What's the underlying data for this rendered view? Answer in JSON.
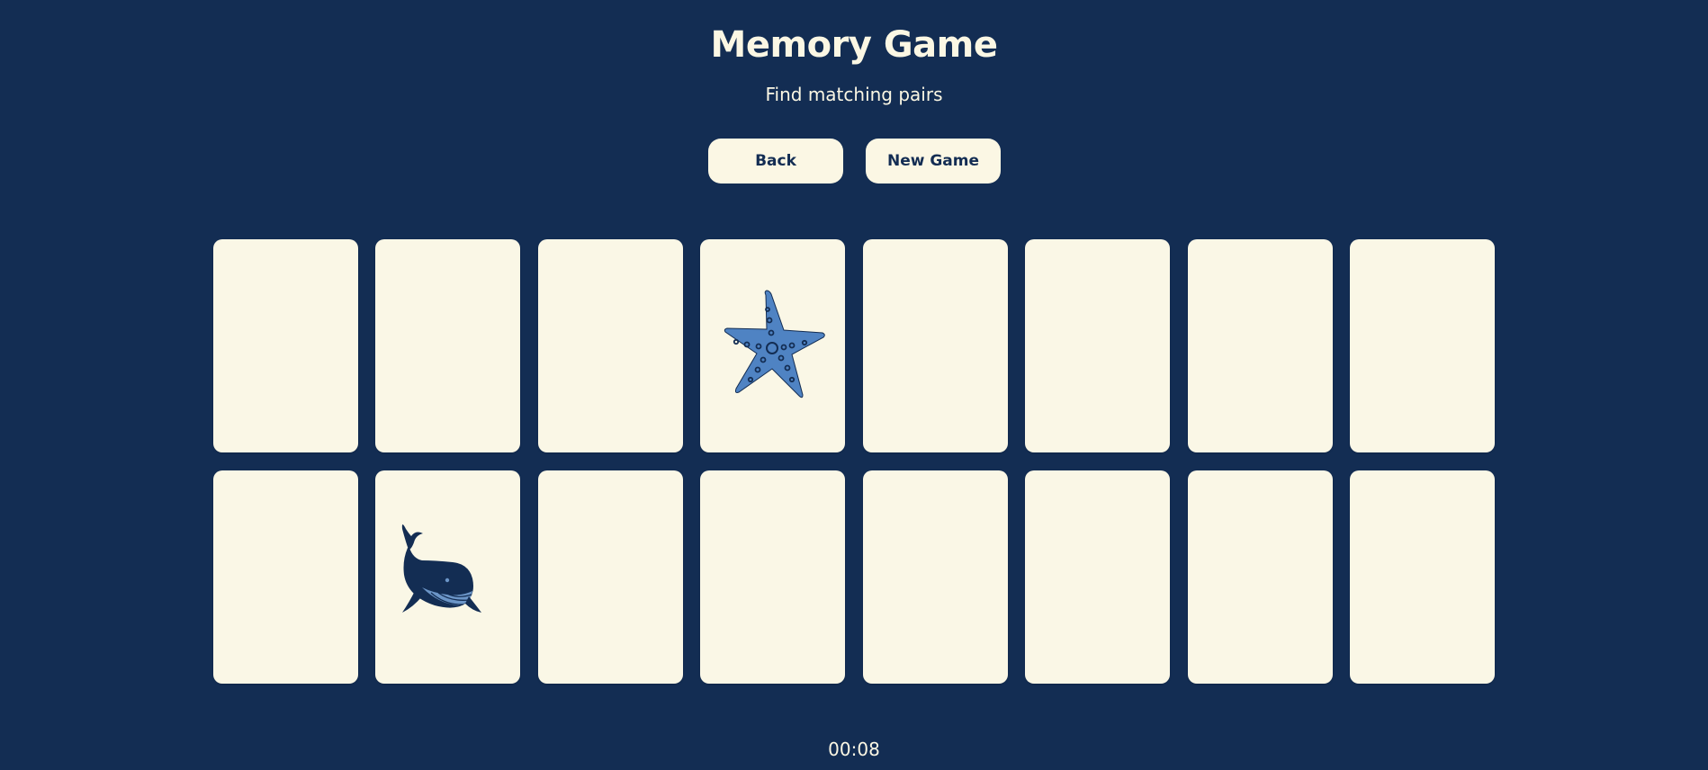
{
  "title": "Memory Game",
  "subtitle": "Find matching pairs",
  "buttons": {
    "back": "Back",
    "new_game": "New Game"
  },
  "timer": "00:08",
  "board": {
    "rows": 2,
    "columns": 8,
    "cards": [
      {
        "face": "hidden"
      },
      {
        "face": "hidden"
      },
      {
        "face": "hidden"
      },
      {
        "face": "starfish-icon"
      },
      {
        "face": "hidden"
      },
      {
        "face": "hidden"
      },
      {
        "face": "hidden"
      },
      {
        "face": "hidden"
      },
      {
        "face": "hidden"
      },
      {
        "face": "whale-icon"
      },
      {
        "face": "hidden"
      },
      {
        "face": "hidden"
      },
      {
        "face": "hidden"
      },
      {
        "face": "hidden"
      },
      {
        "face": "hidden"
      },
      {
        "face": "hidden"
      }
    ]
  },
  "colors": {
    "background": "#132d53",
    "card": "#faf7e6",
    "text": "#fbf7e4",
    "icon_light": "#4f83c3",
    "icon_dark": "#132d53"
  }
}
